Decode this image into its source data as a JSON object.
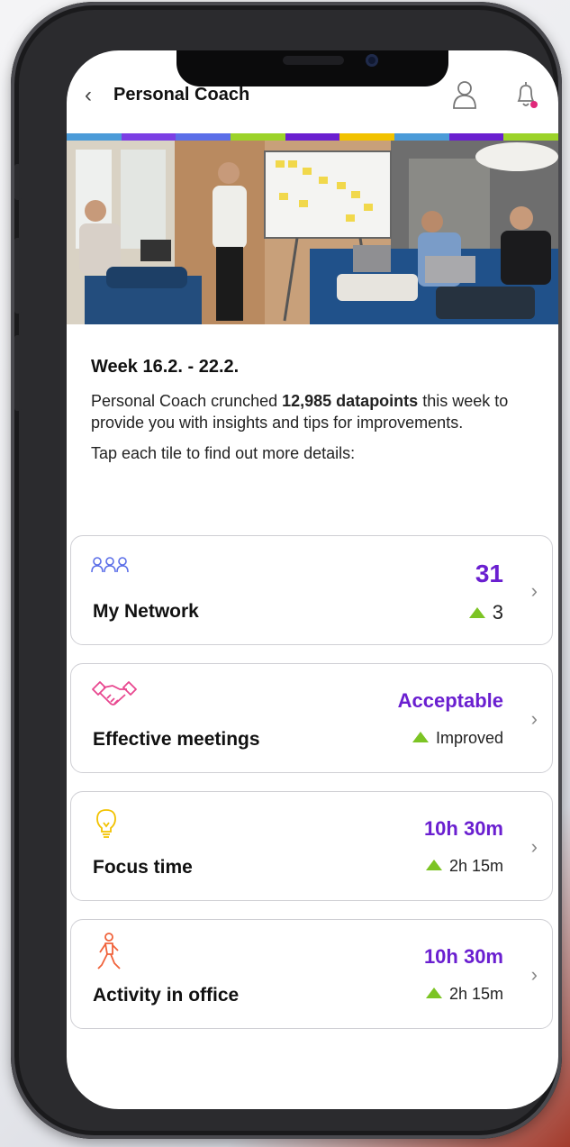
{
  "header": {
    "back_glyph": "‹",
    "title": "Personal Coach"
  },
  "intro": {
    "week": "Week 16.2. - 22.2.",
    "desc_before": "Personal Coach crunched ",
    "desc_bold": "12,985 datapoints",
    "desc_after": " this week to provide you with insights and tips for improvements.",
    "tap": "Tap each tile to find out more details:"
  },
  "tiles": [
    {
      "label": "My Network",
      "value": "31",
      "delta": "3",
      "icon": "people-icon",
      "icon_color": "#5b6ee8"
    },
    {
      "label": "Effective meetings",
      "value": "Acceptable",
      "delta": "Improved",
      "icon": "handshake-icon",
      "icon_color": "#e8478f"
    },
    {
      "label": "Focus time",
      "value": "10h 30m",
      "delta": "2h 15m",
      "icon": "lightbulb-icon",
      "icon_color": "#f2c200"
    },
    {
      "label": "Activity in office",
      "value": "10h 30m",
      "delta": "2h 15m",
      "icon": "walking-person-icon",
      "icon_color": "#f0623a"
    }
  ],
  "chevron_glyph": "›",
  "colors": {
    "accent_purple": "#6a1fd0",
    "delta_green": "#7cc424",
    "stripe": [
      "#4b9bd8",
      "#7b3fe4",
      "#5b6ee8",
      "#9cd32a",
      "#6a1fd0",
      "#f2c200",
      "#4b9bd8",
      "#6a1fd0",
      "#9cd32a"
    ]
  }
}
